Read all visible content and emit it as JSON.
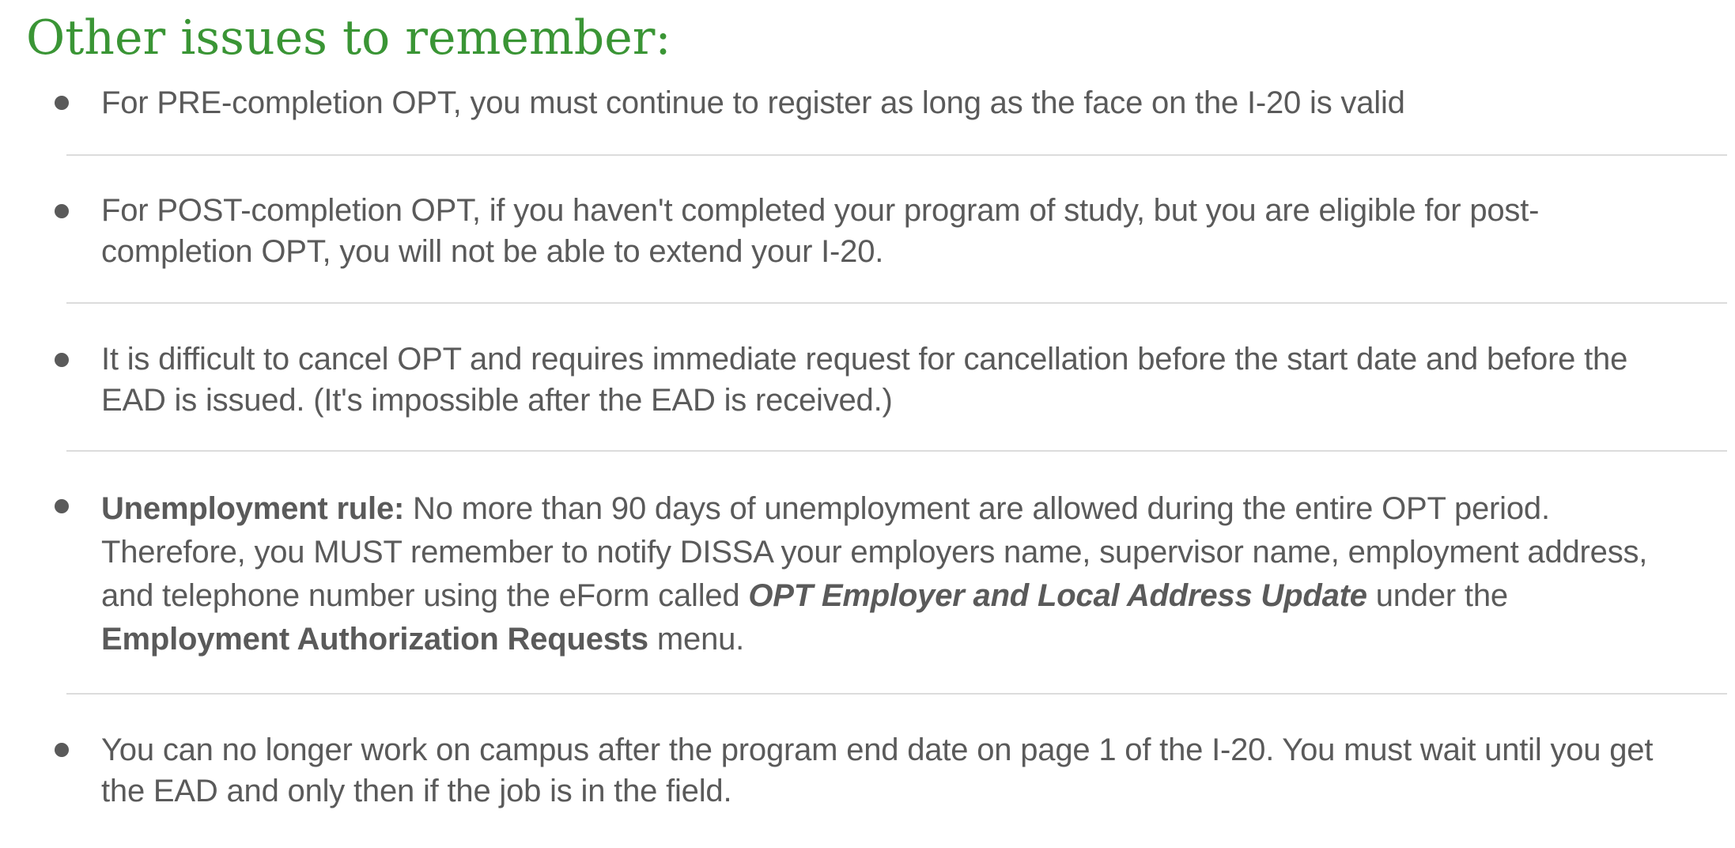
{
  "heading": "Other issues to remember:",
  "items": [
    {
      "text": "For PRE-completion OPT, you must continue to register as long as the face on the I-20 is valid"
    },
    {
      "text": "For POST-completion OPT, if you haven't completed your program of study, but you are eligible for post-completion OPT, you will not be able to extend your I-20."
    },
    {
      "text": "It is difficult  to cancel OPT and requires immediate request for cancellation before the start date and before the EAD is issued.  (It's impossible after the EAD is received.)"
    },
    {
      "lead": "Unemployment rule:",
      "text_1": " No more than 90 days of unemployment are allowed during the entire OPT period. Therefore, you MUST remember to notify DISSA your employers name, supervisor name, employment address, and telephone number using the eForm called ",
      "form_name": "OPT Employer and Local Address Update",
      "text_2": " under the ",
      "menu_name": "Employment Authorization Requests",
      "text_3": " menu."
    },
    {
      "text": "You can no longer work on campus after the program end date on page 1 of the I-20.  You must wait until you get the EAD and only then if the job is in the field."
    }
  ]
}
